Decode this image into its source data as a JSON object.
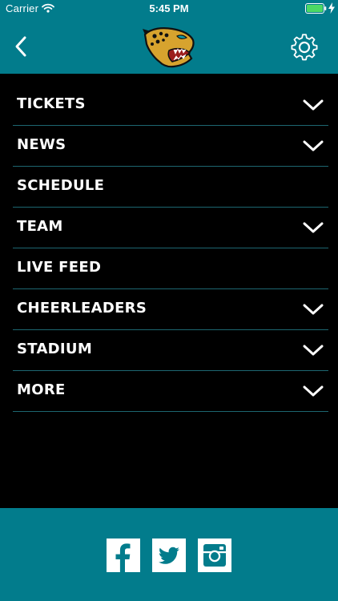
{
  "status_bar": {
    "carrier": "Carrier",
    "time": "5:45 PM",
    "icons": [
      "wifi-icon",
      "battery-icon",
      "charging-bolt-icon"
    ]
  },
  "nav": {
    "back_icon": "chevron-left-icon",
    "logo": "jaguar-head-logo",
    "settings_icon": "gear-icon"
  },
  "menu": {
    "items": [
      {
        "label": "TICKETS",
        "expandable": true
      },
      {
        "label": "NEWS",
        "expandable": true
      },
      {
        "label": "SCHEDULE",
        "expandable": false
      },
      {
        "label": "TEAM",
        "expandable": true
      },
      {
        "label": "LIVE FEED",
        "expandable": false
      },
      {
        "label": "CHEERLEADERS",
        "expandable": true
      },
      {
        "label": "STADIUM",
        "expandable": true
      },
      {
        "label": "MORE",
        "expandable": true
      }
    ]
  },
  "footer": {
    "social": [
      "facebook-icon",
      "twitter-icon",
      "instagram-icon"
    ]
  },
  "colors": {
    "teal": "#027C8C",
    "background": "#000000",
    "divider": "#1D6670",
    "text": "#FFFFFF"
  }
}
